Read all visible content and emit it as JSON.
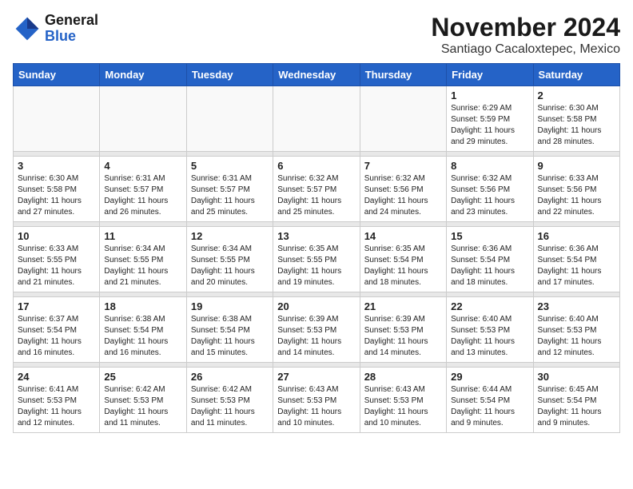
{
  "header": {
    "logo_line1": "General",
    "logo_line2": "Blue",
    "month_title": "November 2024",
    "location": "Santiago Cacaloxtepec, Mexico"
  },
  "weekdays": [
    "Sunday",
    "Monday",
    "Tuesday",
    "Wednesday",
    "Thursday",
    "Friday",
    "Saturday"
  ],
  "weeks": [
    [
      {
        "day": "",
        "info": ""
      },
      {
        "day": "",
        "info": ""
      },
      {
        "day": "",
        "info": ""
      },
      {
        "day": "",
        "info": ""
      },
      {
        "day": "",
        "info": ""
      },
      {
        "day": "1",
        "info": "Sunrise: 6:29 AM\nSunset: 5:59 PM\nDaylight: 11 hours and 29 minutes."
      },
      {
        "day": "2",
        "info": "Sunrise: 6:30 AM\nSunset: 5:58 PM\nDaylight: 11 hours and 28 minutes."
      }
    ],
    [
      {
        "day": "3",
        "info": "Sunrise: 6:30 AM\nSunset: 5:58 PM\nDaylight: 11 hours and 27 minutes."
      },
      {
        "day": "4",
        "info": "Sunrise: 6:31 AM\nSunset: 5:57 PM\nDaylight: 11 hours and 26 minutes."
      },
      {
        "day": "5",
        "info": "Sunrise: 6:31 AM\nSunset: 5:57 PM\nDaylight: 11 hours and 25 minutes."
      },
      {
        "day": "6",
        "info": "Sunrise: 6:32 AM\nSunset: 5:57 PM\nDaylight: 11 hours and 25 minutes."
      },
      {
        "day": "7",
        "info": "Sunrise: 6:32 AM\nSunset: 5:56 PM\nDaylight: 11 hours and 24 minutes."
      },
      {
        "day": "8",
        "info": "Sunrise: 6:32 AM\nSunset: 5:56 PM\nDaylight: 11 hours and 23 minutes."
      },
      {
        "day": "9",
        "info": "Sunrise: 6:33 AM\nSunset: 5:56 PM\nDaylight: 11 hours and 22 minutes."
      }
    ],
    [
      {
        "day": "10",
        "info": "Sunrise: 6:33 AM\nSunset: 5:55 PM\nDaylight: 11 hours and 21 minutes."
      },
      {
        "day": "11",
        "info": "Sunrise: 6:34 AM\nSunset: 5:55 PM\nDaylight: 11 hours and 21 minutes."
      },
      {
        "day": "12",
        "info": "Sunrise: 6:34 AM\nSunset: 5:55 PM\nDaylight: 11 hours and 20 minutes."
      },
      {
        "day": "13",
        "info": "Sunrise: 6:35 AM\nSunset: 5:55 PM\nDaylight: 11 hours and 19 minutes."
      },
      {
        "day": "14",
        "info": "Sunrise: 6:35 AM\nSunset: 5:54 PM\nDaylight: 11 hours and 18 minutes."
      },
      {
        "day": "15",
        "info": "Sunrise: 6:36 AM\nSunset: 5:54 PM\nDaylight: 11 hours and 18 minutes."
      },
      {
        "day": "16",
        "info": "Sunrise: 6:36 AM\nSunset: 5:54 PM\nDaylight: 11 hours and 17 minutes."
      }
    ],
    [
      {
        "day": "17",
        "info": "Sunrise: 6:37 AM\nSunset: 5:54 PM\nDaylight: 11 hours and 16 minutes."
      },
      {
        "day": "18",
        "info": "Sunrise: 6:38 AM\nSunset: 5:54 PM\nDaylight: 11 hours and 16 minutes."
      },
      {
        "day": "19",
        "info": "Sunrise: 6:38 AM\nSunset: 5:54 PM\nDaylight: 11 hours and 15 minutes."
      },
      {
        "day": "20",
        "info": "Sunrise: 6:39 AM\nSunset: 5:53 PM\nDaylight: 11 hours and 14 minutes."
      },
      {
        "day": "21",
        "info": "Sunrise: 6:39 AM\nSunset: 5:53 PM\nDaylight: 11 hours and 14 minutes."
      },
      {
        "day": "22",
        "info": "Sunrise: 6:40 AM\nSunset: 5:53 PM\nDaylight: 11 hours and 13 minutes."
      },
      {
        "day": "23",
        "info": "Sunrise: 6:40 AM\nSunset: 5:53 PM\nDaylight: 11 hours and 12 minutes."
      }
    ],
    [
      {
        "day": "24",
        "info": "Sunrise: 6:41 AM\nSunset: 5:53 PM\nDaylight: 11 hours and 12 minutes."
      },
      {
        "day": "25",
        "info": "Sunrise: 6:42 AM\nSunset: 5:53 PM\nDaylight: 11 hours and 11 minutes."
      },
      {
        "day": "26",
        "info": "Sunrise: 6:42 AM\nSunset: 5:53 PM\nDaylight: 11 hours and 11 minutes."
      },
      {
        "day": "27",
        "info": "Sunrise: 6:43 AM\nSunset: 5:53 PM\nDaylight: 11 hours and 10 minutes."
      },
      {
        "day": "28",
        "info": "Sunrise: 6:43 AM\nSunset: 5:53 PM\nDaylight: 11 hours and 10 minutes."
      },
      {
        "day": "29",
        "info": "Sunrise: 6:44 AM\nSunset: 5:54 PM\nDaylight: 11 hours and 9 minutes."
      },
      {
        "day": "30",
        "info": "Sunrise: 6:45 AM\nSunset: 5:54 PM\nDaylight: 11 hours and 9 minutes."
      }
    ]
  ]
}
